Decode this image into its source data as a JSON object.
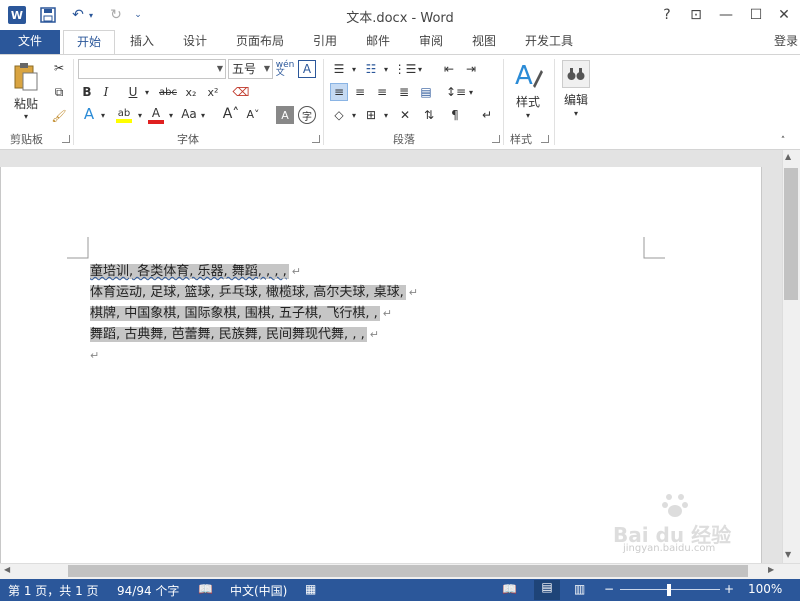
{
  "title": "文本.docx - Word",
  "window_controls": [
    "?",
    "⊡",
    "—",
    "☐",
    "✕"
  ],
  "tabs": [
    {
      "label": "文件"
    },
    {
      "label": "开始"
    },
    {
      "label": "插入"
    },
    {
      "label": "设计"
    },
    {
      "label": "页面布局"
    },
    {
      "label": "引用"
    },
    {
      "label": "邮件"
    },
    {
      "label": "审阅"
    },
    {
      "label": "视图"
    },
    {
      "label": "开发工具"
    }
  ],
  "login": "登录",
  "ribbon": {
    "paste": "粘贴",
    "font_name": "",
    "font_size": "五号",
    "styles": "样式",
    "edit": "编辑",
    "groups": {
      "clipboard": "剪贴板",
      "font": "字体",
      "paragraph": "段落",
      "styles": "样式"
    }
  },
  "document": {
    "lines": [
      "童培训, 各类体育, 乐器, 舞蹈, , , ,",
      "体育运动, 足球, 篮球, 乒乓球, 橄榄球, 高尔夫球, 桌球,",
      "棋牌, 中国象棋, 国际象棋, 围棋, 五子棋, 飞行棋, ,",
      "舞蹈, 古典舞, 芭蕾舞, 民族舞, 民间舞现代舞, , ,"
    ],
    "para_mark": "↵"
  },
  "status": {
    "page": "第 1 页，共 1 页",
    "words": "94/94 个字",
    "lang": "中文(中国)",
    "zoom": "100%"
  },
  "watermark": {
    "brand": "Bai du 经验",
    "url": "jingyan.baidu.com"
  },
  "colors": {
    "accent": "#2b579a",
    "selection": "#c6c6c6"
  }
}
